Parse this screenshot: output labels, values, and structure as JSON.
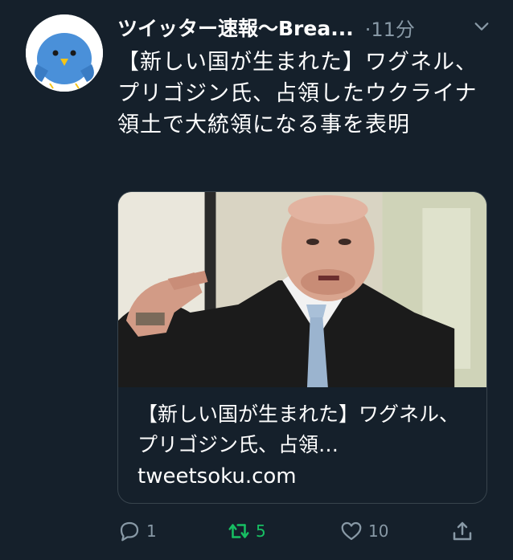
{
  "tweet": {
    "author_name": "ツイッター速報〜Brea...",
    "time": "·11分",
    "text": "【新しい国が生まれた】ワグネル、プリゴジン氏、占領したウクライナ領土で大統領になる事を表明",
    "card": {
      "title": "【新しい国が生まれた】ワグネル、プリゴジン氏、占領…",
      "domain": "tweetsoku.com"
    }
  },
  "actions": {
    "reply_count": "1",
    "retweet_count": "5",
    "like_count": "10"
  },
  "colors": {
    "background": "#15202b",
    "muted": "#8899a6",
    "retweet_active": "#17bf63",
    "card_border": "#38444d"
  }
}
